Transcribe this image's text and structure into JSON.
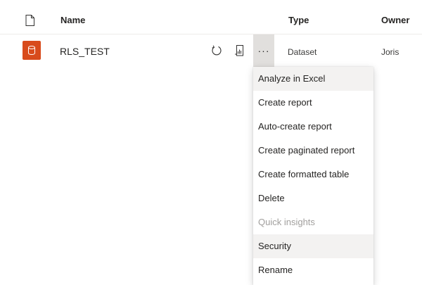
{
  "header": {
    "name_label": "Name",
    "type_label": "Type",
    "owner_label": "Owner"
  },
  "row": {
    "name": "RLS_TEST",
    "type": "Dataset",
    "owner": "Joris",
    "more_glyph": "···",
    "icon_color": "#d84b1c"
  },
  "menu": {
    "items": [
      {
        "label": "Analyze in Excel"
      },
      {
        "label": "Create report"
      },
      {
        "label": "Auto-create report"
      },
      {
        "label": "Create paginated report"
      },
      {
        "label": "Create formatted table"
      },
      {
        "label": "Delete"
      },
      {
        "label": "Quick insights"
      },
      {
        "label": "Security"
      },
      {
        "label": "Rename"
      }
    ]
  }
}
